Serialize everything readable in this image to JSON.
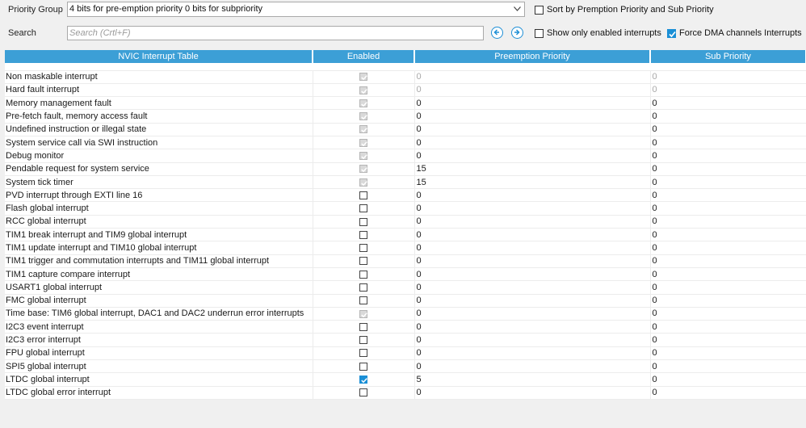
{
  "toolbar": {
    "priority_group_label": "Priority Group",
    "priority_group_value": "4 bits for pre-emption priority 0 bits for subpriority",
    "search_label": "Search",
    "search_placeholder": "Search (Crtl+F)",
    "sort_label": "Sort by Premption Priority and Sub Priority",
    "sort_checked": false,
    "show_enabled_label": "Show only enabled interrupts",
    "show_enabled_checked": false,
    "force_dma_label": "Force DMA channels Interrupts",
    "force_dma_checked": true
  },
  "table": {
    "headers": [
      "NVIC Interrupt Table",
      "Enabled",
      "Preemption Priority",
      "Sub Priority"
    ],
    "rows": [
      {
        "name": "Non maskable interrupt",
        "enabled": "locked",
        "preemption": "0",
        "sub": "0",
        "disabled_values": true
      },
      {
        "name": "Hard fault interrupt",
        "enabled": "locked",
        "preemption": "0",
        "sub": "0",
        "disabled_values": true
      },
      {
        "name": "Memory management fault",
        "enabled": "locked",
        "preemption": "0",
        "sub": "0",
        "disabled_values": false
      },
      {
        "name": "Pre-fetch fault, memory access fault",
        "enabled": "locked",
        "preemption": "0",
        "sub": "0",
        "disabled_values": false
      },
      {
        "name": "Undefined instruction or illegal state",
        "enabled": "locked",
        "preemption": "0",
        "sub": "0",
        "disabled_values": false
      },
      {
        "name": "System service call via SWI instruction",
        "enabled": "locked",
        "preemption": "0",
        "sub": "0",
        "disabled_values": false
      },
      {
        "name": "Debug monitor",
        "enabled": "locked",
        "preemption": "0",
        "sub": "0",
        "disabled_values": false
      },
      {
        "name": "Pendable request for system service",
        "enabled": "locked",
        "preemption": "15",
        "sub": "0",
        "disabled_values": false
      },
      {
        "name": "System tick timer",
        "enabled": "locked",
        "preemption": "15",
        "sub": "0",
        "disabled_values": false
      },
      {
        "name": "PVD interrupt through EXTI line 16",
        "enabled": "off",
        "preemption": "0",
        "sub": "0",
        "disabled_values": false
      },
      {
        "name": "Flash global interrupt",
        "enabled": "off",
        "preemption": "0",
        "sub": "0",
        "disabled_values": false
      },
      {
        "name": "RCC global interrupt",
        "enabled": "off",
        "preemption": "0",
        "sub": "0",
        "disabled_values": false
      },
      {
        "name": "TIM1 break interrupt and TIM9 global interrupt",
        "enabled": "off",
        "preemption": "0",
        "sub": "0",
        "disabled_values": false
      },
      {
        "name": "TIM1 update interrupt and TIM10 global interrupt",
        "enabled": "off",
        "preemption": "0",
        "sub": "0",
        "disabled_values": false
      },
      {
        "name": "TIM1 trigger and commutation interrupts and TIM11 global interrupt",
        "enabled": "off",
        "preemption": "0",
        "sub": "0",
        "disabled_values": false
      },
      {
        "name": "TIM1 capture compare interrupt",
        "enabled": "off",
        "preemption": "0",
        "sub": "0",
        "disabled_values": false
      },
      {
        "name": "USART1 global interrupt",
        "enabled": "off",
        "preemption": "0",
        "sub": "0",
        "disabled_values": false
      },
      {
        "name": "FMC global interrupt",
        "enabled": "off",
        "preemption": "0",
        "sub": "0",
        "disabled_values": false
      },
      {
        "name": "Time base: TIM6 global interrupt, DAC1 and DAC2 underrun error interrupts",
        "enabled": "locked",
        "preemption": "0",
        "sub": "0",
        "disabled_values": false
      },
      {
        "name": "I2C3 event interrupt",
        "enabled": "off",
        "preemption": "0",
        "sub": "0",
        "disabled_values": false
      },
      {
        "name": "I2C3 error interrupt",
        "enabled": "off",
        "preemption": "0",
        "sub": "0",
        "disabled_values": false
      },
      {
        "name": "FPU global interrupt",
        "enabled": "off",
        "preemption": "0",
        "sub": "0",
        "disabled_values": false
      },
      {
        "name": "SPI5 global interrupt",
        "enabled": "off",
        "preemption": "0",
        "sub": "0",
        "disabled_values": false
      },
      {
        "name": "LTDC global interrupt",
        "enabled": "on",
        "preemption": "5",
        "sub": "0",
        "disabled_values": false
      },
      {
        "name": "LTDC global error interrupt",
        "enabled": "off",
        "preemption": "0",
        "sub": "0",
        "disabled_values": false
      }
    ]
  },
  "colors": {
    "header_bg": "#3c9fd6",
    "accent": "#1a8fd6",
    "disabled_text": "#a8a8a8"
  }
}
